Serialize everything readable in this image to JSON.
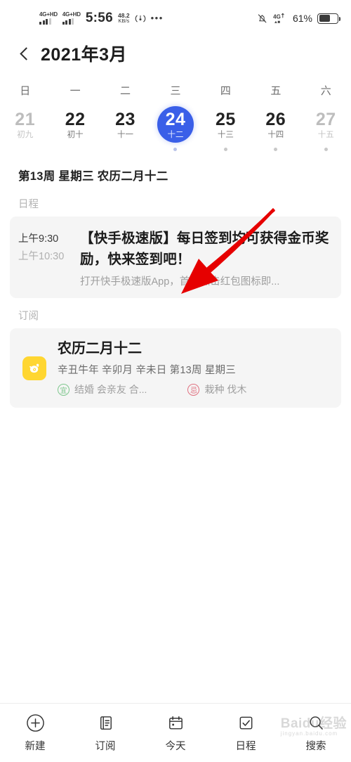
{
  "status_bar": {
    "sim1_label": "4G+HD",
    "sim2_label": "4G+HD",
    "time": "5:56",
    "net_speed_value": "48.2",
    "net_speed_unit": "KB/s",
    "hotspot_icon": "hotspot-icon",
    "overflow_icon": "more-dots-icon",
    "mute_icon": "bell-muted-icon",
    "data_label": "4G",
    "battery_percent": "61%",
    "battery_level": 61
  },
  "header": {
    "back_icon": "chevron-left-icon",
    "title": "2021年3月"
  },
  "calendar": {
    "weekday_headers": [
      "日",
      "一",
      "二",
      "三",
      "四",
      "五",
      "六"
    ],
    "days": [
      {
        "num": "21",
        "lunar": "初九",
        "state": "dim",
        "dot": "none"
      },
      {
        "num": "22",
        "lunar": "初十",
        "state": "normal",
        "dot": "none"
      },
      {
        "num": "23",
        "lunar": "十一",
        "state": "normal",
        "dot": "none"
      },
      {
        "num": "24",
        "lunar": "十二",
        "state": "selected",
        "dot": "light"
      },
      {
        "num": "25",
        "lunar": "十三",
        "state": "normal",
        "dot": "gray"
      },
      {
        "num": "26",
        "lunar": "十四",
        "state": "normal",
        "dot": "gray"
      },
      {
        "num": "27",
        "lunar": "十五",
        "state": "dim",
        "dot": "gray"
      }
    ],
    "selected_circle_color": "#3a5fe8",
    "info_line": "第13周 星期三 农历二月十二"
  },
  "schedule": {
    "section_label": "日程",
    "event": {
      "start_time": "上午9:30",
      "end_time": "上午10:30",
      "title": "【快手极速版】每日签到均可获得金币奖励，快来签到吧！",
      "subtitle": "打开快手极速版App，首页点击红包图标即..."
    }
  },
  "subscription": {
    "section_label": "订阅",
    "card": {
      "icon": "ox-zodiac-icon",
      "icon_color": "#ffd631",
      "title": "农历二月十二",
      "meta": "辛丑牛年 辛卯月 辛未日 第13周 星期三",
      "good_badge": "宜",
      "good_badge_color": "#7ec78d",
      "good_items": "结婚 会亲友 合...",
      "bad_badge": "忌",
      "bad_badge_color": "#e0707f",
      "bad_items": "栽种 伐木"
    }
  },
  "annotation": {
    "arrow_color": "#e60000",
    "arrow_name": "red-pointer-arrow"
  },
  "bottom_nav": [
    {
      "icon": "plus-circle-icon",
      "label": "新建"
    },
    {
      "icon": "subscribe-book-icon",
      "label": "订阅"
    },
    {
      "icon": "calendar-today-icon",
      "label": "今天"
    },
    {
      "icon": "checkbox-icon",
      "label": "日程"
    },
    {
      "icon": "search-icon",
      "label": "搜索"
    }
  ],
  "watermark": {
    "text": "Baidu经验",
    "sub": "jingyan.baidu.com"
  }
}
